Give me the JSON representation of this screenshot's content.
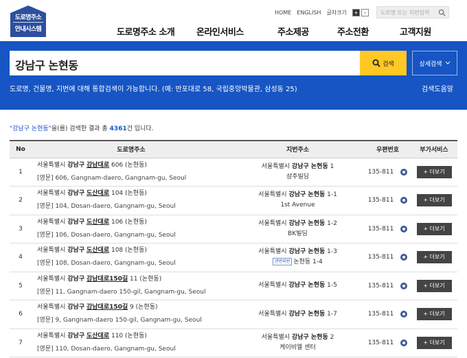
{
  "brand": {
    "logo_line1": "도로명주소",
    "logo_line2": "안내시스템"
  },
  "util": {
    "home": "HOME",
    "english": "ENGLISH",
    "font_size": "글자크기",
    "zoom_in": "+",
    "zoom_out": "–",
    "search_placeholder": "도로명 또는 지번입력"
  },
  "nav": [
    "도로명주소 소개",
    "온라인서비스",
    "주소제공",
    "주소전환",
    "고객지원"
  ],
  "search": {
    "query": "강남구 논현동",
    "button": "검색",
    "advanced": "상세검색",
    "hint": "도로명, 건물명, 지번에 대해 통합검색이 가능합니다. (예: 반포대로 58, 국립중앙박물관, 삼성동 25)",
    "help": "검색도움말"
  },
  "results": {
    "keyword": "\"강남구 논현동\"",
    "prefix": "을(를) 검색한 결과 총 ",
    "total": "4361",
    "suffix": "건 입니다."
  },
  "table": {
    "headers": [
      "No",
      "도로명주소",
      "지번주소",
      "우편번호",
      "부가서비스"
    ],
    "more_label": "+ 더보기",
    "rows": [
      {
        "no": "1",
        "road_pre": "서울특별시 ",
        "road_gu": "강남구",
        "road_name": "강남대로",
        "road_rest": " 606 (논현동)",
        "eng": "[영문] 606, Gangnam-daero, Gangnam-gu, Seoul",
        "jibun_pre": "서울특별시 ",
        "jibun_gu": "강남구 논현동",
        "jibun_rest": " 1",
        "jibun_extra": "삼주빌딩",
        "related": "",
        "zip": "135-811"
      },
      {
        "no": "2",
        "road_pre": "서울특별시 ",
        "road_gu": "강남구",
        "road_name": "도산대로",
        "road_rest": " 104 (논현동)",
        "eng": "[영문] 104, Dosan-daero, Gangnam-gu, Seoul",
        "jibun_pre": "서울특별시 ",
        "jibun_gu": "강남구 논현동",
        "jibun_rest": " 1-1",
        "jibun_extra": "1st Avenue",
        "related": "",
        "zip": "135-811"
      },
      {
        "no": "3",
        "road_pre": "서울특별시 ",
        "road_gu": "강남구",
        "road_name": "도산대로",
        "road_rest": " 106 (논현동)",
        "eng": "[영문] 106, Dosan-daero, Gangnam-gu, Seoul",
        "jibun_pre": "서울특별시 ",
        "jibun_gu": "강남구 논현동",
        "jibun_rest": " 1-2",
        "jibun_extra": "BK빌딩",
        "related": "",
        "zip": "135-811"
      },
      {
        "no": "4",
        "road_pre": "서울특별시 ",
        "road_gu": "강남구",
        "road_name": "도산대로",
        "road_rest": " 108 (논현동)",
        "eng": "[영문] 108, Dosan-daero, Gangnam-gu, Seoul",
        "jibun_pre": "서울특별시 ",
        "jibun_gu": "강남구 논현동",
        "jibun_rest": " 1-3",
        "jibun_extra": "논현동 1-4",
        "related": "관련지번",
        "zip": "135-811"
      },
      {
        "no": "5",
        "road_pre": "서울특별시 ",
        "road_gu": "강남구",
        "road_name": "강남대로150길",
        "road_rest": " 11 (논현동)",
        "eng": "[영문] 11, Gangnam-daero 150-gil, Gangnam-gu, Seoul",
        "jibun_pre": "서울특별시 ",
        "jibun_gu": "강남구 논현동",
        "jibun_rest": " 1-5",
        "jibun_extra": "",
        "related": "",
        "zip": "135-811"
      },
      {
        "no": "6",
        "road_pre": "서울특별시 ",
        "road_gu": "강남구",
        "road_name": "강남대로150길",
        "road_rest": " 9 (논현동)",
        "eng": "[영문] 9, Gangnam-daero 150-gil, Gangnam-gu, Seoul",
        "jibun_pre": "서울특별시 ",
        "jibun_gu": "강남구 논현동",
        "jibun_rest": " 1-7",
        "jibun_extra": "",
        "related": "",
        "zip": "135-811"
      },
      {
        "no": "7",
        "road_pre": "서울특별시 ",
        "road_gu": "강남구",
        "road_name": "도산대로",
        "road_rest": " 110 (논현동)",
        "eng": "[영문] 110, Dosan-daero, Gangnam-gu, Seoul",
        "jibun_pre": "서울특별시 ",
        "jibun_gu": "강남구 논현동",
        "jibun_rest": " 2",
        "jibun_extra": "케이비엘 센터",
        "related": "",
        "zip": "135-811"
      }
    ]
  },
  "colors": {
    "primary": "#1655c3",
    "accent": "#ffc824",
    "logo": "#2d4f9e",
    "button_dark": "#444444"
  }
}
